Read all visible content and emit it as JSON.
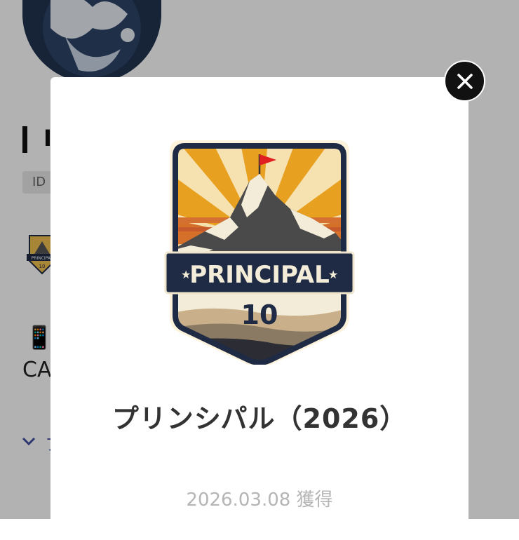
{
  "profile": {
    "name_text": "I",
    "id_label": "ID",
    "small_badge": {
      "label": "PRINCIPAL",
      "level": "10"
    },
    "ca_text": "CA",
    "section_label": "フ"
  },
  "modal": {
    "badge": {
      "banner_text": "PRINCIPAL",
      "level": "10"
    },
    "title": "プリンシパル（2026）",
    "date": "2026.03.08 獲得",
    "close_icon": "close-icon"
  },
  "colors": {
    "overlay": "#000000",
    "banner": "#1f2a44",
    "sun": "#e8a020",
    "flag": "#e02020",
    "date_text": "#b5b5b5"
  }
}
